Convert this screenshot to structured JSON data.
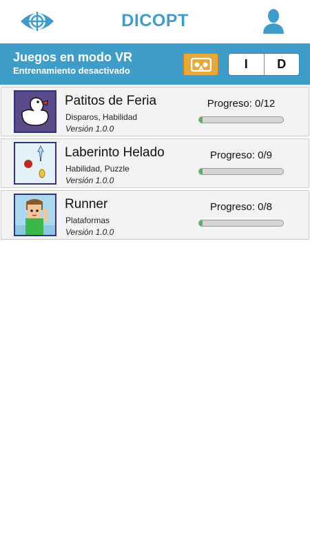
{
  "header": {
    "title": "DICOPT",
    "logo_icon": "eye-crosshair-icon",
    "profile_icon": "user-silhouette-icon",
    "accent_color": "#3e9ec9"
  },
  "vr_panel": {
    "title": "Juegos en modo VR",
    "subtitle": "Entrenamiento desactivado",
    "vr_button_icon": "vr-headset-icon",
    "vr_button_color": "#e7a83a",
    "eye_options": [
      "I",
      "D"
    ]
  },
  "games": [
    {
      "name": "Patitos de Feria",
      "tags": "Disparos, Habilidad",
      "version": "Versión 1.0.0",
      "progress_label": "Progreso: 0/12",
      "progress": 0.04,
      "thumb_icon": "duck-icon"
    },
    {
      "name": "Laberinto Helado",
      "tags": "Habilidad, Puzzle",
      "version": "Versión 1.0.0",
      "progress_label": "Progreso: 0/9",
      "progress": 0.04,
      "thumb_icon": "ice-maze-icon"
    },
    {
      "name": "Runner",
      "tags": "Plataformas",
      "version": "Versión 1.0.0",
      "progress_label": "Progreso: 0/8",
      "progress": 0.04,
      "thumb_icon": "runner-character-icon"
    }
  ]
}
